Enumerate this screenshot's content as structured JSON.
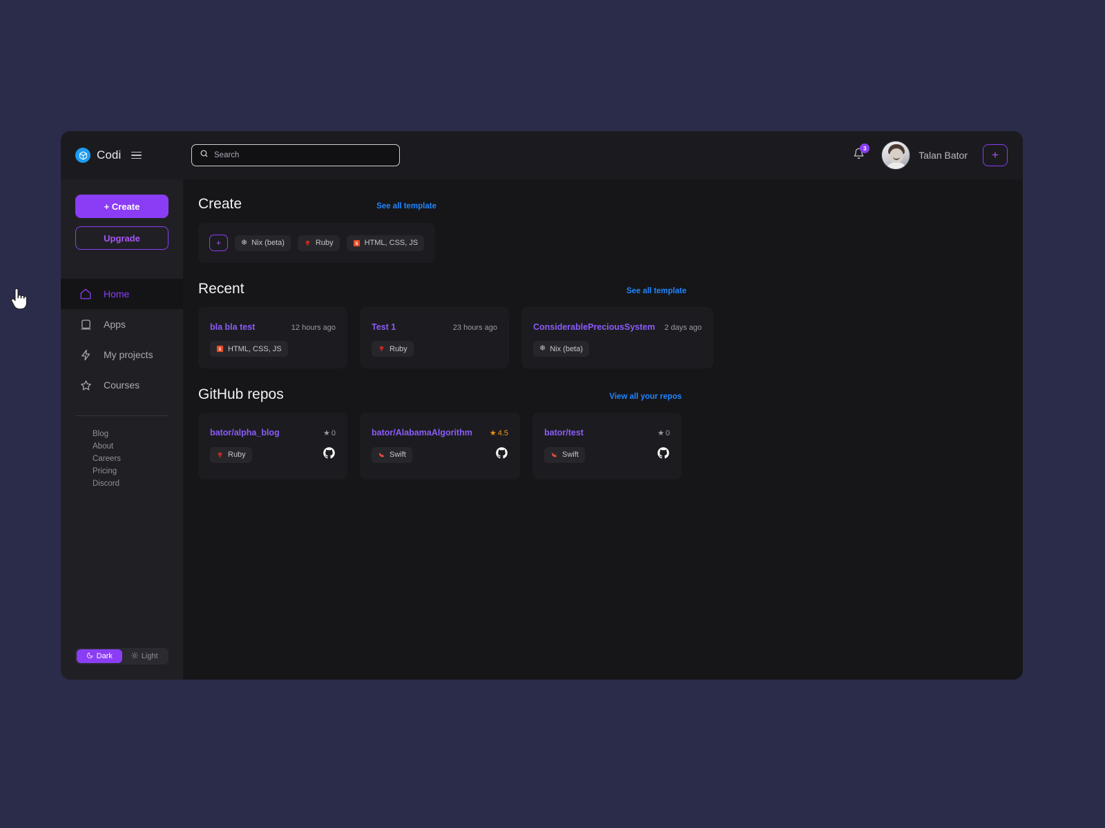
{
  "brand": {
    "name": "Codi",
    "logo_icon": "cube-icon",
    "menu_icon": "hamburger-icon"
  },
  "search": {
    "placeholder": "Search",
    "value": "",
    "icon": "search-icon"
  },
  "header": {
    "notifications_icon": "bell-icon",
    "notifications_count": "3",
    "user_name": "Talan Bator",
    "avatar_icon": "avatar",
    "add_button_label": "+"
  },
  "sidebar": {
    "create_label": "+ Create",
    "upgrade_label": "Upgrade",
    "nav": [
      {
        "label": "Home",
        "icon": "home-icon",
        "active": true
      },
      {
        "label": "Apps",
        "icon": "app-square-icon",
        "active": false
      },
      {
        "label": "My projects",
        "icon": "lightning-bolt-icon",
        "active": false
      },
      {
        "label": "Courses",
        "icon": "star-outline-icon",
        "active": false
      }
    ],
    "links": [
      "Blog",
      "About",
      "Careers",
      "Pricing",
      "Discord"
    ],
    "theme": {
      "dark_label": "Dark",
      "light_label": "Light",
      "dark_icon": "moon-icon",
      "light_icon": "sun-icon",
      "selected": "Dark"
    }
  },
  "main": {
    "create": {
      "title": "Create",
      "link": "See all template",
      "add_button_label": "+",
      "templates": [
        {
          "label": "Nix (beta)",
          "icon": "nix-snowflake-icon"
        },
        {
          "label": "Ruby",
          "icon": "ruby-gem-icon"
        },
        {
          "label": "HTML, CSS, JS",
          "icon": "html5-icon"
        }
      ]
    },
    "recent": {
      "title": "Recent",
      "link": "See all template",
      "items": [
        {
          "name": "bla bla test",
          "time": "12 hours ago",
          "lang": "HTML, CSS, JS",
          "lang_icon": "html5-icon"
        },
        {
          "name": "Test 1",
          "time": "23 hours ago",
          "lang": "Ruby",
          "lang_icon": "ruby-gem-icon"
        },
        {
          "name": "ConsiderablePreciousSystem",
          "time": "2 days ago",
          "lang": "Nix (beta)",
          "lang_icon": "nix-snowflake-icon"
        }
      ]
    },
    "github": {
      "title": "GitHub repos",
      "link": "View all your repos",
      "items": [
        {
          "name": "bator/alpha_blog",
          "stars": "0",
          "rated": false,
          "lang": "Ruby",
          "lang_icon": "ruby-gem-icon",
          "source_icon": "github-icon"
        },
        {
          "name": "bator/AlabamaAlgorithm",
          "stars": "4.5",
          "rated": true,
          "lang": "Swift",
          "lang_icon": "swift-bird-icon",
          "source_icon": "github-icon"
        },
        {
          "name": "bator/test",
          "stars": "0",
          "rated": false,
          "lang": "Swift",
          "lang_icon": "swift-bird-icon",
          "source_icon": "github-icon"
        }
      ]
    }
  },
  "colors": {
    "page_background": "#2b2c49",
    "accent_purple": "#8b3df5",
    "link_blue": "#1f86ff",
    "star_orange": "#f59215",
    "card_background": "#1c1c20"
  }
}
